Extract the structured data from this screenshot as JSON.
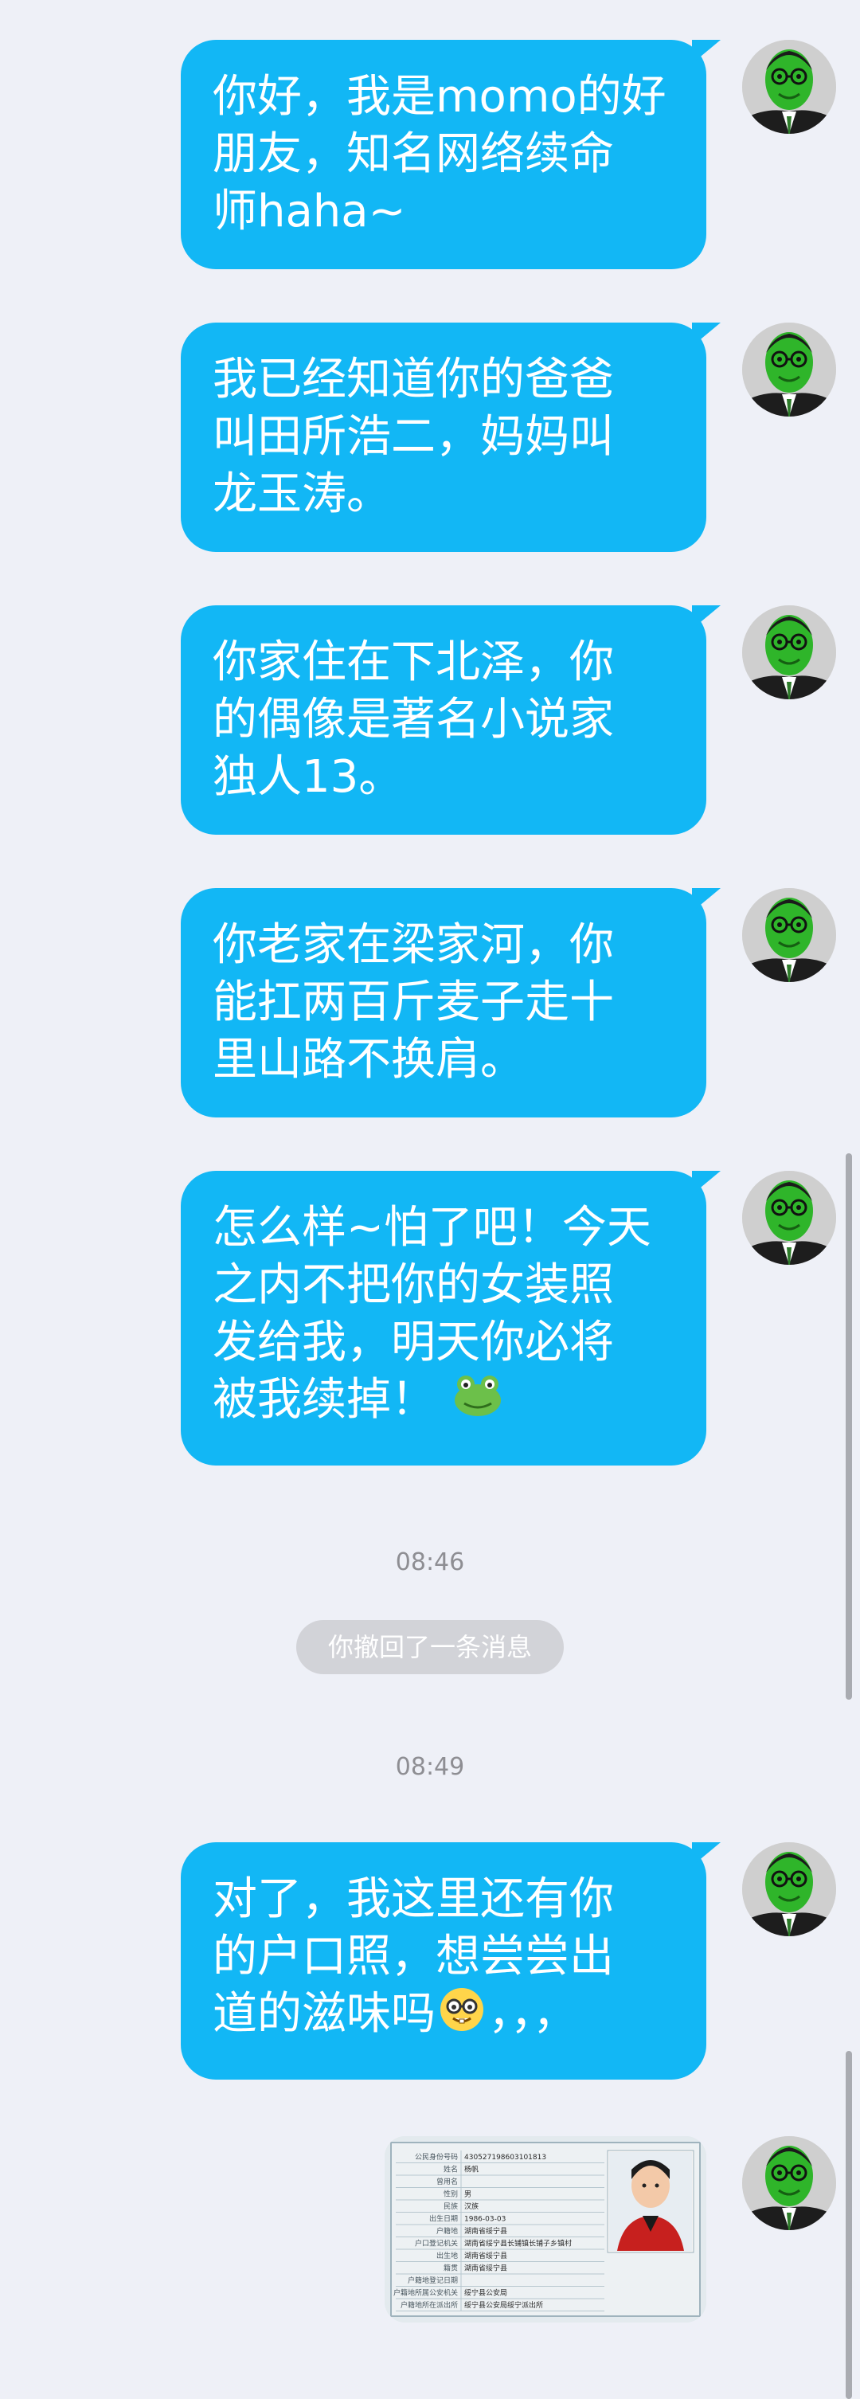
{
  "messages": [
    {
      "lines": [
        "你好，我是momo的好",
        "朋友，知名网络续命",
        "师haha~"
      ]
    },
    {
      "lines": [
        "我已经知道你的爸爸",
        "叫田所浩二，妈妈叫",
        "龙玉涛。"
      ]
    },
    {
      "lines": [
        "你家住在下北泽，你",
        "的偶像是著名小说家",
        "独人13。"
      ]
    },
    {
      "lines": [
        "你老家在梁家河，你",
        "能扛两百斤麦子走十",
        "里山路不换肩。"
      ]
    },
    {
      "lines": [
        "怎么样~怕了吧！今天",
        "之内不把你的女装照",
        "发给我，明天你必将",
        "被我续掉！"
      ]
    },
    {
      "lines": [
        "对了，我这里还有你",
        "的户口照，想尝尝出",
        "道的滋味吗",
        "，，，"
      ]
    }
  ],
  "timestamps": [
    "08:46",
    "08:49"
  ],
  "recall_notice": "你撤回了一条消息",
  "icons": {
    "avatar": "green-face-with-glasses-avatar",
    "frog": "frog-emoji-icon",
    "nerd": "nerd-face-emoji-icon"
  },
  "photo": {
    "type": "household-register-photo",
    "fields": [
      "公民身份号码",
      "姓名",
      "曾用名",
      "性别",
      "民族",
      "出生日期",
      "户籍地",
      "户口登记机关",
      "出生地",
      "籍贯",
      "户籍地登记日期",
      "户籍地所属公安机关",
      "户籍地所在派出所"
    ],
    "values": [
      "430527198603101813",
      "杨帆",
      "",
      "男",
      "汉族",
      "1986-03-03",
      "湖南省绥宁县",
      "湖南省绥宁县长铺镇长铺子乡镇村",
      "湖南省绥宁县",
      "湖南省绥宁县",
      "",
      "绥宁县公安局",
      "绥宁县公安局绥宁派出所"
    ]
  },
  "colors": {
    "background": "#eef0f7",
    "bubble": "#12b7f5",
    "bubble_text": "#ffffff",
    "timestamp": "#8e8e93",
    "recall_pill": "#d2d3d8"
  }
}
